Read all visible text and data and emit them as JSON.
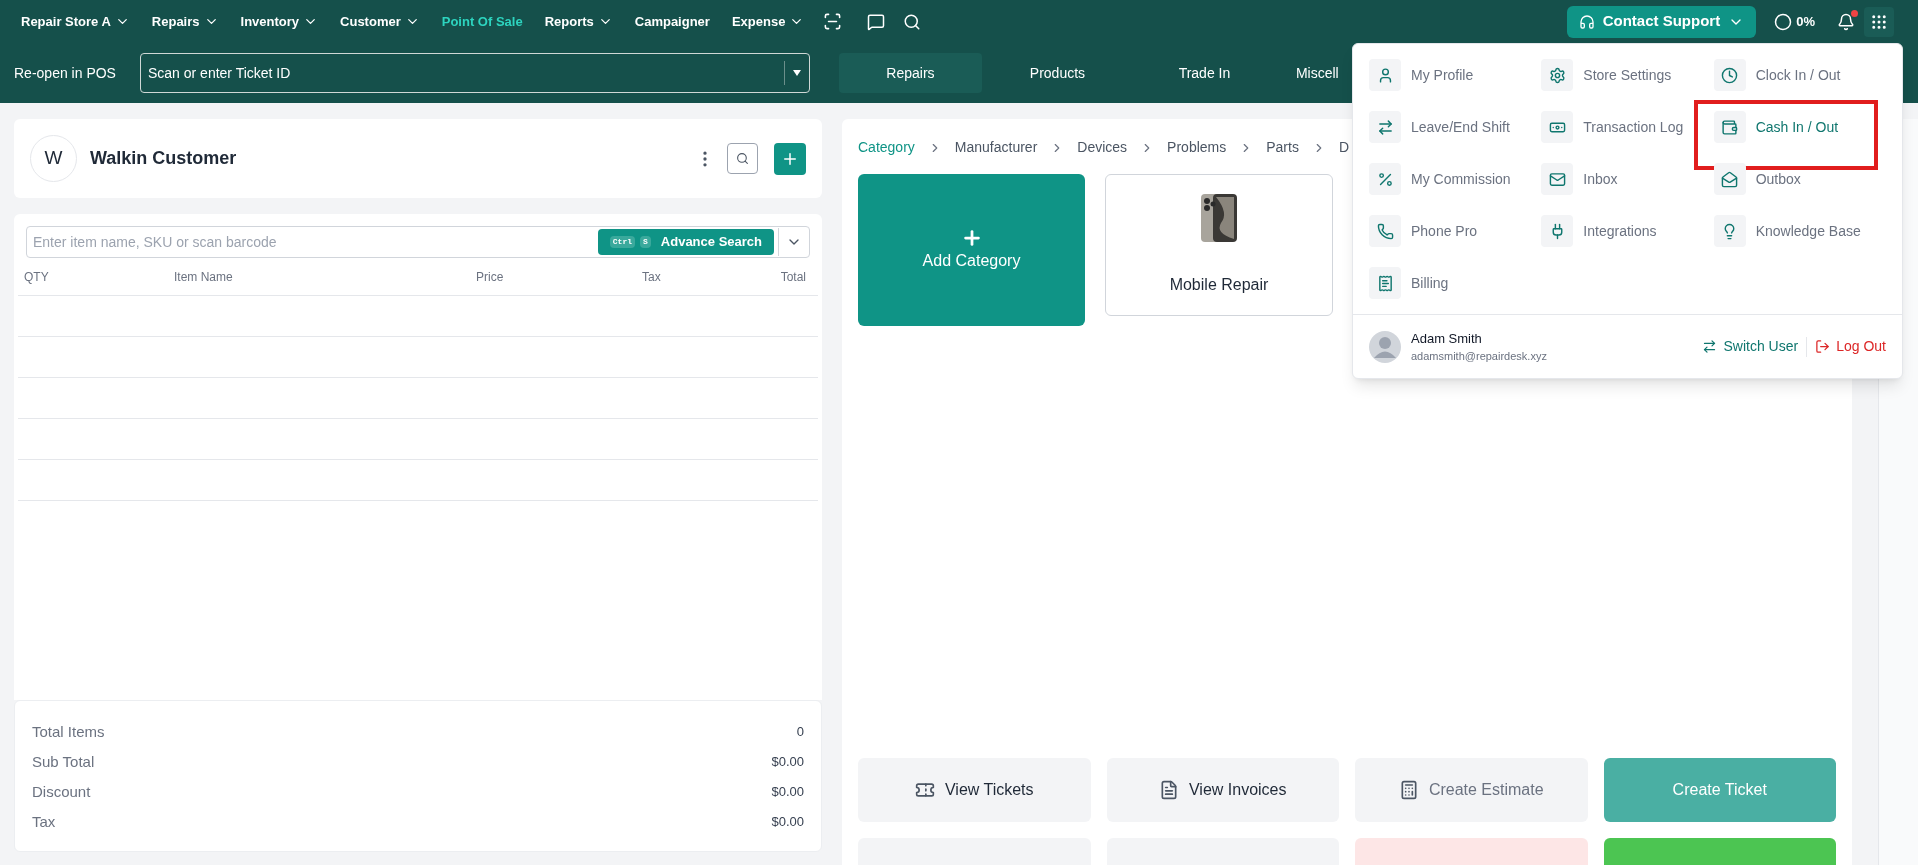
{
  "nav": {
    "items": [
      {
        "label": "Repair Store A",
        "has_menu": true,
        "selected": false
      },
      {
        "label": "Repairs",
        "has_menu": true,
        "selected": false
      },
      {
        "label": "Inventory",
        "has_menu": true,
        "selected": false
      },
      {
        "label": "Customer",
        "has_menu": true,
        "selected": false
      },
      {
        "label": "Point Of Sale",
        "has_menu": false,
        "selected": true
      },
      {
        "label": "Reports",
        "has_menu": true,
        "selected": false
      },
      {
        "label": "Campaigner",
        "has_menu": false,
        "selected": false
      },
      {
        "label": "Expense",
        "has_menu": true,
        "selected": false
      }
    ],
    "support_button": "Contact Support",
    "progress": "0%",
    "notification_dot": true
  },
  "reopen": {
    "label": "Re-open in POS",
    "placeholder": "Scan or enter Ticket ID"
  },
  "tabs": [
    {
      "label": "Repairs",
      "selected": true
    },
    {
      "label": "Products",
      "selected": false
    },
    {
      "label": "Trade In",
      "selected": false
    },
    {
      "label": "Miscell",
      "selected": false
    }
  ],
  "customer": {
    "initial": "W",
    "name": "Walkin Customer"
  },
  "item_search": {
    "placeholder": "Enter item name, SKU or scan barcode",
    "keys": [
      "Ctrl",
      "S"
    ],
    "button": "Advance Search"
  },
  "items_table": {
    "columns": [
      "QTY",
      "Item Name",
      "Price",
      "Tax",
      "Total"
    ]
  },
  "summary": [
    {
      "label": "Total Items",
      "value": "0"
    },
    {
      "label": "Sub Total",
      "value": "$0.00"
    },
    {
      "label": "Discount",
      "value": "$0.00"
    },
    {
      "label": "Tax",
      "value": "$0.00"
    }
  ],
  "breadcrumb": [
    {
      "label": "Category",
      "selected": true
    },
    {
      "label": "Manufacturer",
      "selected": false
    },
    {
      "label": "Devices",
      "selected": false
    },
    {
      "label": "Problems",
      "selected": false
    },
    {
      "label": "Parts",
      "selected": false
    },
    {
      "label": "D",
      "selected": false
    }
  ],
  "tiles": [
    {
      "kind": "add",
      "label": "Add Category"
    },
    {
      "kind": "category",
      "label": "Mobile Repair"
    }
  ],
  "actions": [
    {
      "kind": "neutral",
      "label": "View Tickets"
    },
    {
      "kind": "neutral",
      "label": "View Invoices"
    },
    {
      "kind": "disabled",
      "label": "Create Estimate"
    },
    {
      "kind": "primary",
      "label": "Create Ticket"
    },
    {
      "kind": "neutral"
    },
    {
      "kind": "neutral"
    },
    {
      "kind": "danger"
    },
    {
      "kind": "success"
    }
  ],
  "menu": {
    "items": [
      {
        "label": "My Profile",
        "selected": false,
        "highlighted": false
      },
      {
        "label": "Store Settings",
        "selected": false,
        "highlighted": false
      },
      {
        "label": "Clock In / Out",
        "selected": false,
        "highlighted": false
      },
      {
        "label": "Leave/End Shift",
        "selected": false,
        "highlighted": false
      },
      {
        "label": "Transaction Log",
        "selected": false,
        "highlighted": false
      },
      {
        "label": "Cash In / Out",
        "selected": true,
        "highlighted": true
      },
      {
        "label": "My Commission",
        "selected": false,
        "highlighted": false
      },
      {
        "label": "Inbox",
        "selected": false,
        "highlighted": false
      },
      {
        "label": "Outbox",
        "selected": false,
        "highlighted": false
      },
      {
        "label": "Phone Pro",
        "selected": false,
        "highlighted": false
      },
      {
        "label": "Integrations",
        "selected": false,
        "highlighted": false
      },
      {
        "label": "Knowledge Base",
        "selected": false,
        "highlighted": false
      },
      {
        "label": "Billing",
        "selected": false,
        "highlighted": false
      }
    ],
    "user": {
      "name": "Adam Smith",
      "email": "adamsmith@repairdesk.xyz"
    },
    "switch_user": "Switch User",
    "log_out": "Log Out"
  }
}
